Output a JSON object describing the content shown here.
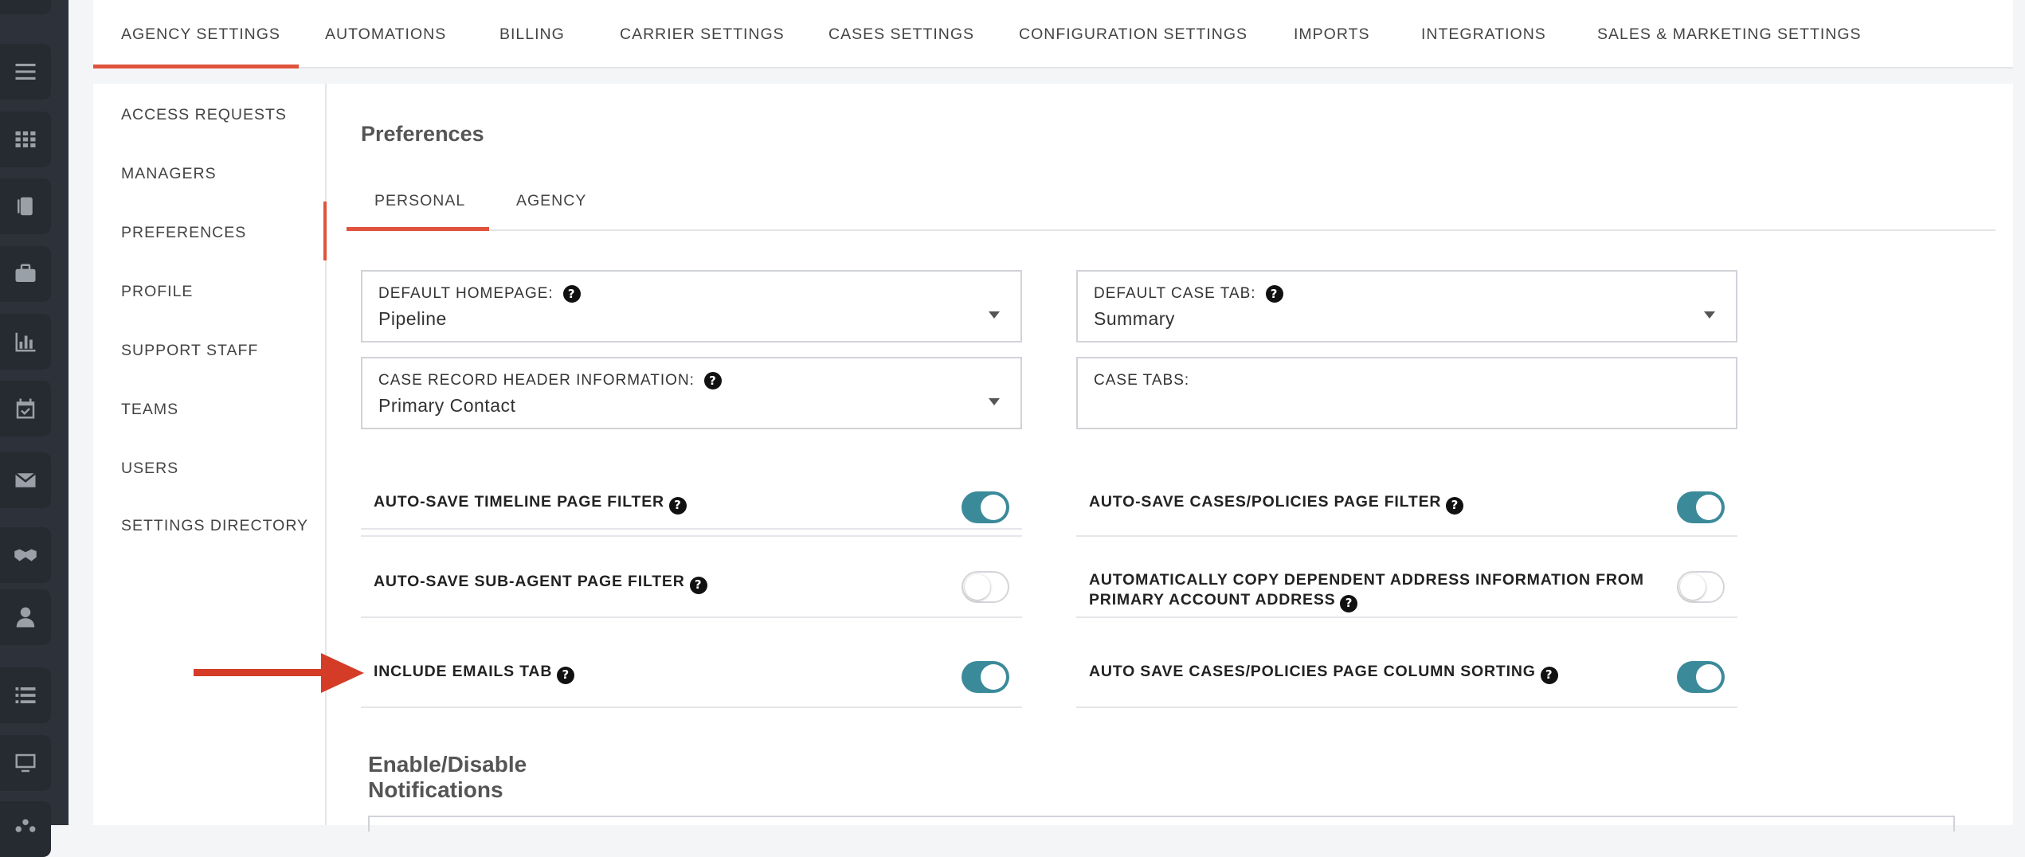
{
  "colors": {
    "accent": "#e0533d",
    "toggle_on": "#3b8a9a",
    "rail": "#2d323a"
  },
  "rail": {
    "icons": [
      "pie-chart-icon",
      "menu-lines-icon",
      "grid-icon",
      "cards-icon",
      "briefcase-icon",
      "bar-chart-icon",
      "calendar-check-icon",
      "envelope-icon",
      "handshake-icon",
      "person-icon",
      "list-icon",
      "monitor-icon",
      "org-icon"
    ]
  },
  "top_tabs": [
    {
      "label": "AGENCY SETTINGS",
      "active": true
    },
    {
      "label": "AUTOMATIONS"
    },
    {
      "label": "BILLING"
    },
    {
      "label": "CARRIER SETTINGS"
    },
    {
      "label": "CASES SETTINGS"
    },
    {
      "label": "CONFIGURATION SETTINGS"
    },
    {
      "label": "IMPORTS"
    },
    {
      "label": "INTEGRATIONS"
    },
    {
      "label": "SALES & MARKETING SETTINGS"
    }
  ],
  "sidebar": {
    "items": [
      {
        "label": "ACCESS REQUESTS"
      },
      {
        "label": "MANAGERS"
      },
      {
        "label": "PREFERENCES",
        "active": true
      },
      {
        "label": "PROFILE"
      },
      {
        "label": "SUPPORT STAFF"
      },
      {
        "label": "TEAMS"
      },
      {
        "label": "USERS"
      },
      {
        "label": "SETTINGS DIRECTORY"
      }
    ]
  },
  "main": {
    "title": "Preferences",
    "subtabs": [
      {
        "label": "PERSONAL",
        "active": true
      },
      {
        "label": "AGENCY"
      }
    ],
    "fields": {
      "default_homepage": {
        "label": "DEFAULT HOMEPAGE:",
        "value": "Pipeline"
      },
      "default_case_tab": {
        "label": "DEFAULT CASE TAB:",
        "value": "Summary"
      },
      "case_record_header": {
        "label": "CASE RECORD HEADER INFORMATION:",
        "value": "Primary Contact"
      },
      "case_tabs": {
        "label": "CASE TABS:",
        "value": ""
      }
    },
    "toggles": {
      "autosave_timeline": {
        "label": "AUTO-SAVE TIMELINE PAGE FILTER",
        "on": true
      },
      "autosave_cases": {
        "label": "AUTO-SAVE CASES/POLICIES PAGE FILTER",
        "on": true
      },
      "autosave_subagent": {
        "label": "AUTO-SAVE SUB-AGENT PAGE FILTER",
        "on": false
      },
      "auto_copy_address_line1": "AUTOMATICALLY COPY DEPENDENT ADDRESS INFORMATION FROM",
      "auto_copy_address_line2": "PRIMARY ACCOUNT ADDRESS",
      "auto_copy_address_on": false,
      "include_emails": {
        "label": "INCLUDE EMAILS TAB",
        "on": true
      },
      "auto_save_sorting": {
        "label": "AUTO SAVE CASES/POLICIES PAGE COLUMN SORTING",
        "on": true
      }
    },
    "notifications_title": "Enable/Disable Notifications"
  },
  "help_glyph": "?"
}
